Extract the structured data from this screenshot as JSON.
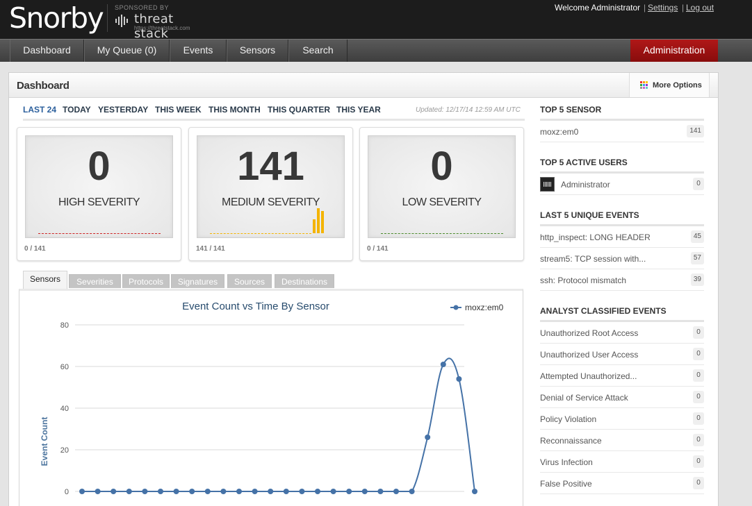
{
  "header": {
    "logo": "Snorby",
    "sponsored_by": "SPONSORED BY",
    "sponsor_name": "threat stack",
    "sponsor_url": "https://threatstack.com",
    "welcome": "Welcome Administrator",
    "separator": "|",
    "settings": "Settings",
    "logout": "Log out"
  },
  "nav": {
    "items": [
      {
        "label": "Dashboard"
      },
      {
        "label": "My Queue (0)"
      },
      {
        "label": "Events"
      },
      {
        "label": "Sensors"
      },
      {
        "label": "Search"
      }
    ],
    "admin": "Administration"
  },
  "dashboard": {
    "title": "Dashboard",
    "more_options": "More Options",
    "time_tabs": [
      "LAST 24",
      "TODAY",
      "YESTERDAY",
      "THIS WEEK",
      "THIS MONTH",
      "THIS QUARTER",
      "THIS YEAR"
    ],
    "active_time_tab": "LAST 24",
    "updated": "Updated: 12/17/14 12:59 AM UTC"
  },
  "severity": [
    {
      "count": "0",
      "label": "HIGH SEVERITY",
      "footer": "0 / 141",
      "color": "#cc2222"
    },
    {
      "count": "141",
      "label": "MEDIUM SEVERITY",
      "footer": "141 / 141",
      "color": "#f4b400"
    },
    {
      "count": "0",
      "label": "LOW SEVERITY",
      "footer": "0 / 141",
      "color": "#4a8a2a"
    }
  ],
  "chart_tabs": [
    "Sensors",
    "Severities",
    "Protocols",
    "Signatures",
    "Sources",
    "Destinations"
  ],
  "chart_data": {
    "type": "line",
    "title": "Event Count vs Time By Sensor",
    "ylabel": "Event Count",
    "ylim": [
      0,
      80
    ],
    "yticks": [
      0,
      20,
      40,
      60,
      80
    ],
    "series": [
      {
        "name": "moxz:em0",
        "color": "#4572a7",
        "values": [
          0,
          0,
          0,
          0,
          0,
          0,
          0,
          0,
          0,
          0,
          0,
          0,
          0,
          0,
          0,
          0,
          0,
          0,
          0,
          0,
          0,
          0,
          26,
          61,
          54,
          0
        ]
      }
    ]
  },
  "right": {
    "top_sensor": {
      "title": "TOP 5 SENSOR",
      "items": [
        {
          "label": "moxz:em0",
          "count": "141"
        }
      ]
    },
    "top_users": {
      "title": "TOP 5 ACTIVE USERS",
      "items": [
        {
          "label": "Administrator",
          "count": "0"
        }
      ]
    },
    "unique_events": {
      "title": "LAST 5 UNIQUE EVENTS",
      "items": [
        {
          "label": "http_inspect: LONG HEADER",
          "count": "45"
        },
        {
          "label": "stream5: TCP session with...",
          "count": "57"
        },
        {
          "label": "ssh: Protocol mismatch",
          "count": "39"
        }
      ]
    },
    "classified": {
      "title": "ANALYST CLASSIFIED EVENTS",
      "items": [
        {
          "label": "Unauthorized Root Access",
          "count": "0"
        },
        {
          "label": "Unauthorized User Access",
          "count": "0"
        },
        {
          "label": "Attempted Unauthorized...",
          "count": "0"
        },
        {
          "label": "Denial of Service Attack",
          "count": "0"
        },
        {
          "label": "Policy Violation",
          "count": "0"
        },
        {
          "label": "Reconnaissance",
          "count": "0"
        },
        {
          "label": "Virus Infection",
          "count": "0"
        },
        {
          "label": "False Positive",
          "count": "0"
        }
      ]
    }
  }
}
